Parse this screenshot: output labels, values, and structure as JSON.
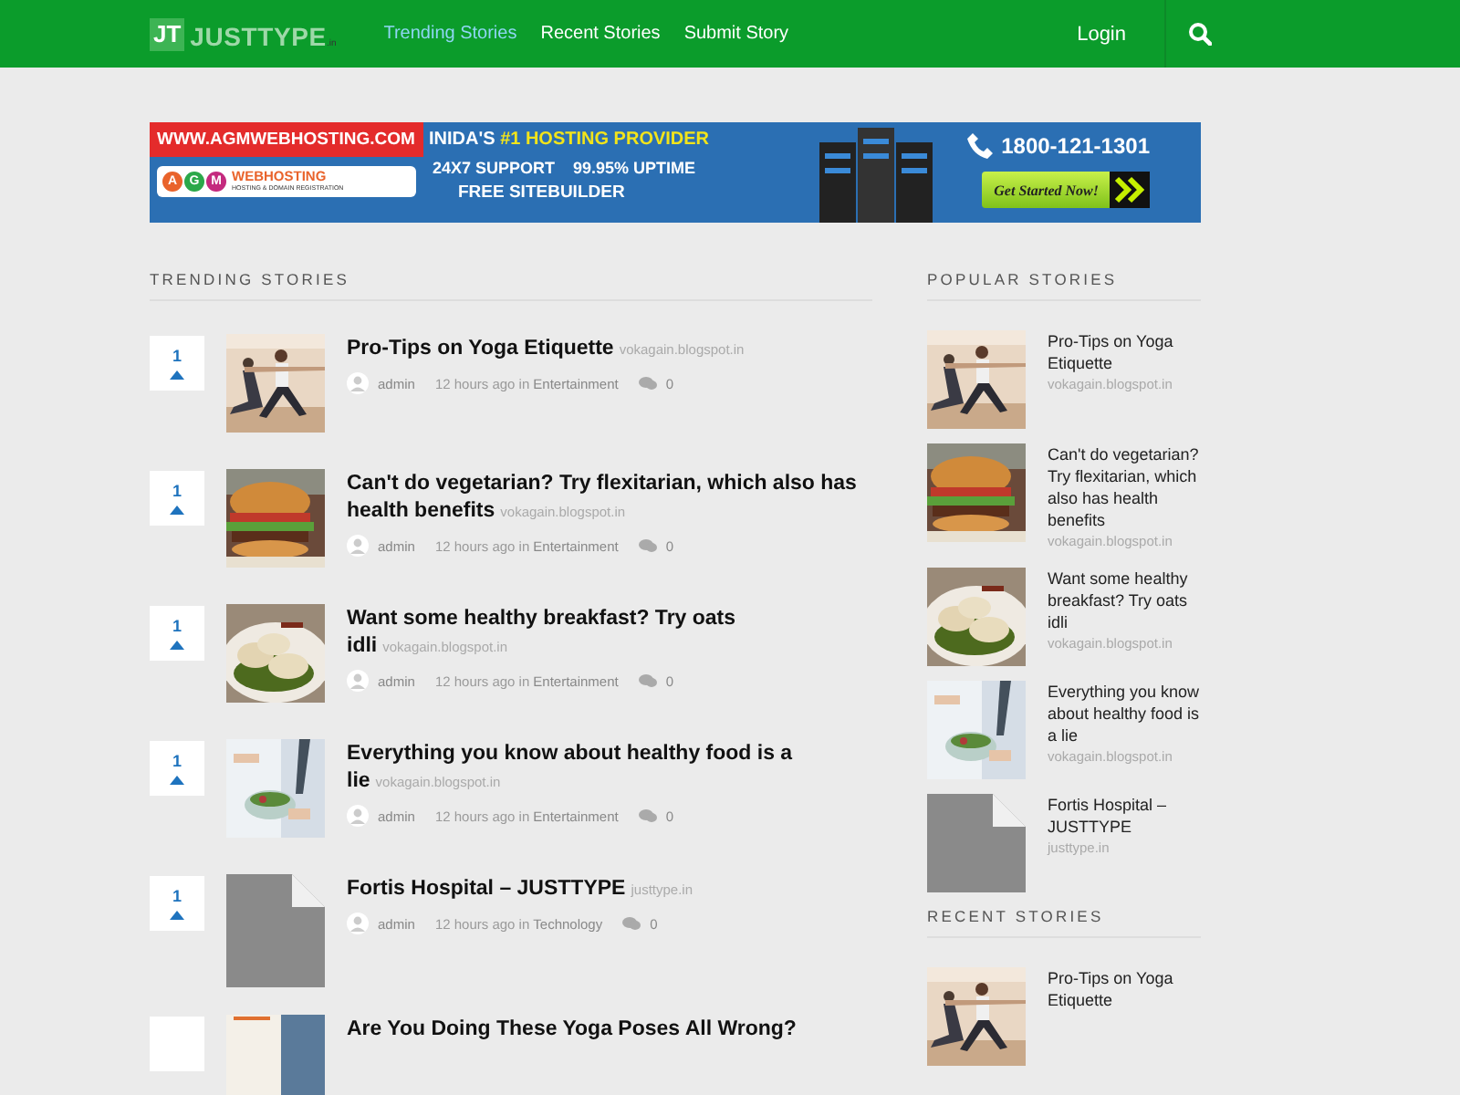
{
  "header": {
    "logo_mark": "JT",
    "logo_text": "JUSTTYPE",
    "logo_suffix": ".in",
    "nav": [
      {
        "label": "Trending Stories",
        "selected": true
      },
      {
        "label": "Recent Stories",
        "selected": false
      },
      {
        "label": "Submit Story",
        "selected": false
      }
    ],
    "login": "Login"
  },
  "banner": {
    "url": "WWW.AGMWEBHOSTING.COM",
    "brand_letters": [
      "A",
      "G",
      "M"
    ],
    "brand": "WEBHOSTING",
    "brand_sub": "HOSTING & DOMAIN REGISTRATION",
    "headline": "INIDA'S **#1 HOSTING PROVIDER**",
    "line2": [
      "24X7 SUPPORT",
      "99.95% UPTIME"
    ],
    "line3": "FREE SITEBUILDER",
    "phone": "1800-121-1301",
    "cta": "Get Started Now!"
  },
  "trending": {
    "title": "TRENDING STORIES",
    "stories": [
      {
        "votes": "1",
        "kind": "picture",
        "title": "Pro-Tips on Yoga Etiquette",
        "source": "vokagain.blogspot.in",
        "author": "admin",
        "time": "12 hours ago in",
        "category": "Entertainment",
        "comments": "0"
      },
      {
        "votes": "1",
        "kind": "picture",
        "title": "Can't do vegetarian? Try flexitarian, which also has health benefits",
        "source": "vokagain.blogspot.in",
        "author": "admin",
        "time": "12 hours ago in",
        "category": "Entertainment",
        "comments": "0"
      },
      {
        "votes": "1",
        "kind": "picture",
        "title": "Want some healthy breakfast? Try oats idli",
        "source": "vokagain.blogspot.in",
        "author": "admin",
        "time": "12 hours ago in",
        "category": "Entertainment",
        "comments": "0"
      },
      {
        "votes": "1",
        "kind": "picture",
        "title": "Everything you know about healthy food is a lie",
        "source": "vokagain.blogspot.in",
        "author": "admin",
        "time": "12 hours ago in",
        "category": "Entertainment",
        "comments": "0"
      },
      {
        "votes": "1",
        "kind": "document",
        "title": "Fortis Hospital – JUSTTYPE",
        "source": "justtype.in",
        "author": "admin",
        "time": "12 hours ago in",
        "category": "Technology",
        "comments": "0"
      },
      {
        "kind": "picture",
        "title": "Are You Doing These Yoga Poses All Wrong?"
      }
    ]
  },
  "popular": {
    "title": "POPULAR STORIES",
    "stories": [
      {
        "kind": "picture",
        "title": "Pro-Tips on Yoga Etiquette",
        "source": "vokagain.blogspot.in"
      },
      {
        "kind": "picture",
        "title": "Can't do vegetarian? Try flexitarian, which also has health benefits",
        "source": "vokagain.blogspot.in"
      },
      {
        "kind": "picture",
        "title": "Want some healthy breakfast? Try oats idli",
        "source": "vokagain.blogspot.in"
      },
      {
        "kind": "picture",
        "title": "Everything you know about healthy food is a lie",
        "source": "vokagain.blogspot.in"
      },
      {
        "kind": "document",
        "title": "Fortis Hospital – JUSTTYPE",
        "source": "justtype.in"
      }
    ]
  },
  "recent": {
    "title": "RECENT STORIES",
    "stories": [
      {
        "kind": "picture",
        "title": "Pro-Tips on Yoga Etiquette"
      }
    ]
  }
}
